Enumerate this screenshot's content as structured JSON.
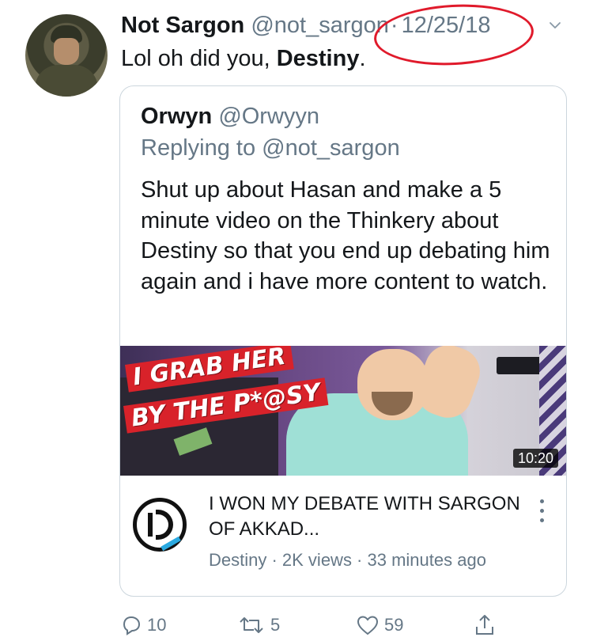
{
  "tweet": {
    "author_name": "Not Sargon",
    "author_handle": "@not_sargon",
    "separator": "·",
    "date": "12/25/18",
    "text_before": "Lol oh did you, ",
    "text_bold": "Destiny",
    "text_after": "."
  },
  "quote": {
    "author_name": "Orwyn",
    "author_handle": "@Orwyyn",
    "replying_to": "Replying to @not_sargon",
    "text": "Shut up about Hasan and make a 5 minute video on the Thinkery about Destiny so that you end up debating him again and i have more content to watch.",
    "video": {
      "thumbnail_caption_line1": "I GRAB HER",
      "thumbnail_caption_line2": "BY THE P*@SY",
      "duration": "10:20",
      "title": "I WON MY DEBATE WITH SARGON OF AKKAD...",
      "meta": "Destiny · 2K views · 33 minutes ago"
    }
  },
  "actions": {
    "replies": "10",
    "retweets": "5",
    "likes": "59"
  },
  "icons": {
    "caret": "chevron-down-icon",
    "reply": "reply-icon",
    "retweet": "retweet-icon",
    "like": "heart-icon",
    "share": "share-icon",
    "more": "more-options-icon"
  },
  "colors": {
    "text": "#14171a",
    "secondary": "#657786",
    "border": "#ccd6dd",
    "annotation": "#e01a2b",
    "thumbnail_banner": "#d8222a"
  }
}
